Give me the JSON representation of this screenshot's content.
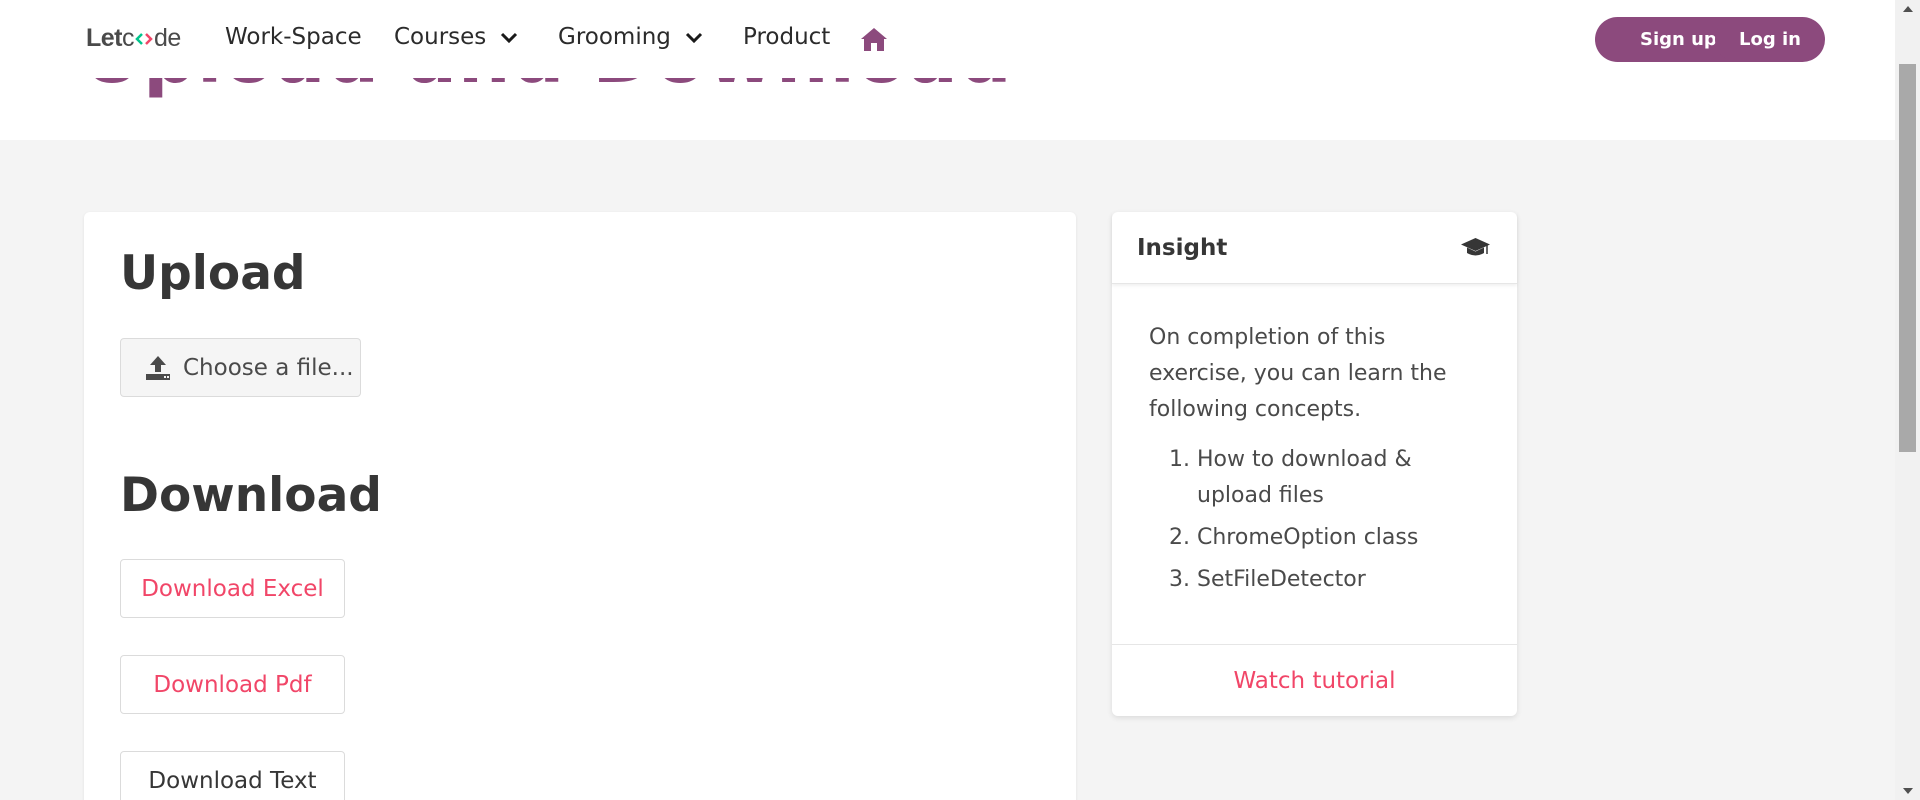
{
  "page": {
    "hero_title": "Upload and Download"
  },
  "navbar": {
    "logo": {
      "prefix": "Let",
      "mid": "c",
      "suffix": "de"
    },
    "items": [
      {
        "label": "Work-Space"
      },
      {
        "label": "Courses"
      },
      {
        "label": "Grooming"
      },
      {
        "label": "Product"
      }
    ],
    "signup_label": "Sign up",
    "login_label": "Log in"
  },
  "upload": {
    "title": "Upload",
    "file_button_label": "Choose a file..."
  },
  "download": {
    "title": "Download",
    "excel_label": "Download Excel",
    "pdf_label": "Download Pdf",
    "text_label": "Download Text"
  },
  "insight": {
    "title": "Insight",
    "intro": "On completion of this exercise, you can learn the following concepts.",
    "items": [
      "How to download & upload files",
      "ChromeOption class",
      "SetFileDetector"
    ],
    "footer_link": "Watch tutorial"
  },
  "colors": {
    "brand": "#8c4a7d",
    "link_danger": "#f14668",
    "logo_accent_green": "#00c48c",
    "logo_accent_pink": "#f14668"
  },
  "icons": {
    "home": "home-icon",
    "chevron": "chevron-down-icon",
    "upload": "upload-icon",
    "graduation": "graduation-cap-icon"
  }
}
